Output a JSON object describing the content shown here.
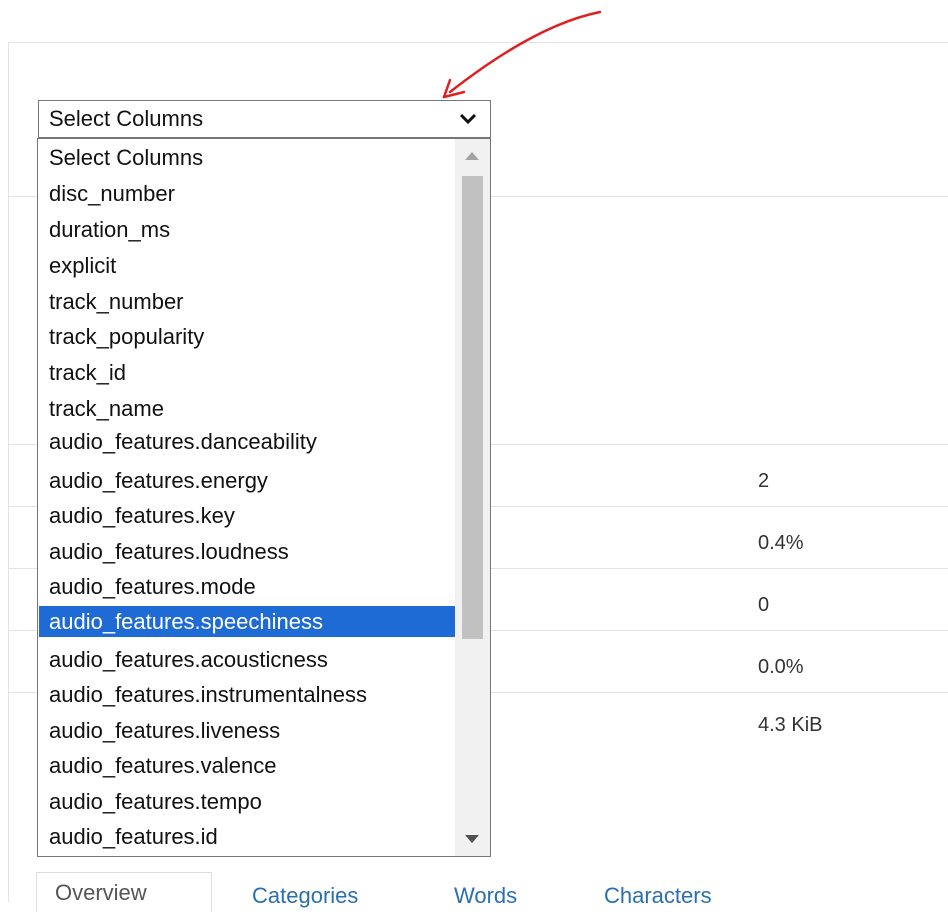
{
  "select": {
    "value": "Select Columns",
    "options": [
      "Select Columns",
      "disc_number",
      "duration_ms",
      "explicit",
      "track_number",
      "track_popularity",
      "track_id",
      "track_name",
      "audio_features.danceability",
      "audio_features.energy",
      "audio_features.key",
      "audio_features.loudness",
      "audio_features.mode",
      "audio_features.speechiness",
      "audio_features.acousticness",
      "audio_features.instrumentalness",
      "audio_features.liveness",
      "audio_features.valence",
      "audio_features.tempo",
      "audio_features.id"
    ],
    "highlighted": "audio_features.speechiness"
  },
  "stats": {
    "values": [
      "2",
      "0.4%",
      "0",
      "0.0%",
      "4.3 KiB"
    ]
  },
  "tabs": [
    {
      "label": "Overview",
      "active": true
    },
    {
      "label": "Categories",
      "active": false
    },
    {
      "label": "Words",
      "active": false
    },
    {
      "label": "Characters",
      "active": false
    }
  ],
  "colors": {
    "highlight": "#1f6bd6",
    "annotation": "#e02020",
    "link": "#2a6fb0"
  },
  "icons": {
    "select_chevron": "chevron-down-icon",
    "scroll_up": "triangle-up-icon",
    "scroll_down": "triangle-down-icon",
    "annotation": "red-arrow-annotation"
  }
}
